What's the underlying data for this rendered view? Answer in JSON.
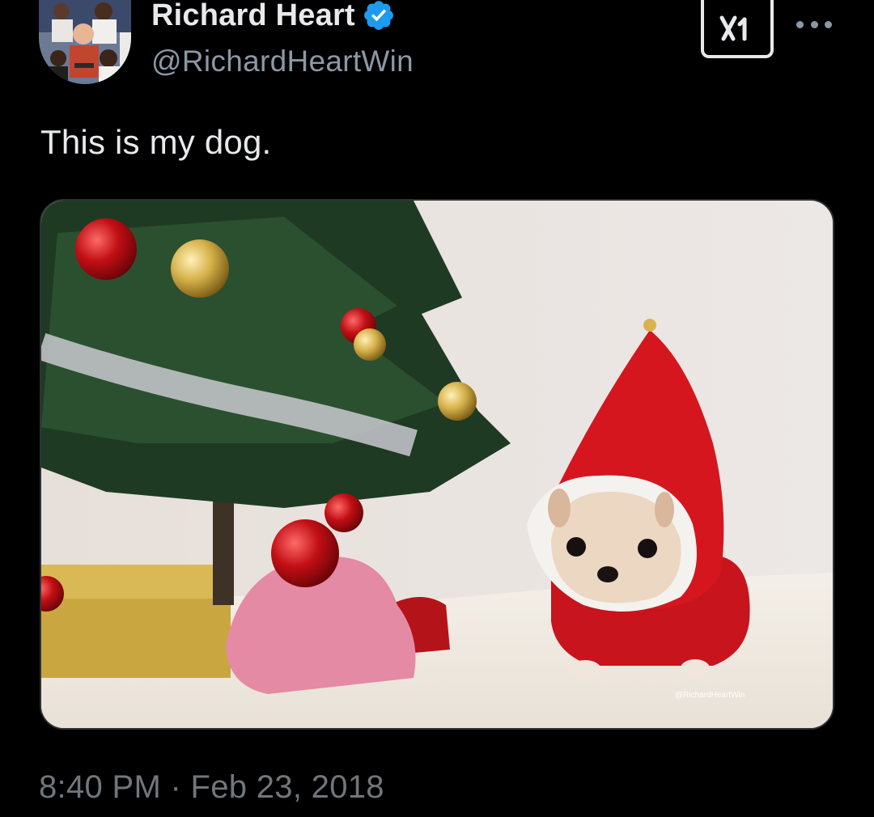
{
  "author": {
    "display_name": "Richard Heart",
    "handle": "@RichardHeartWin",
    "verified_color": "#1d9bf0"
  },
  "tweet": {
    "text": "This is my dog.",
    "timestamp": "8:40 PM · Feb 23, 2018"
  },
  "media": {
    "watermark": "@RichardHeartWin"
  },
  "actions": {
    "grok_icon": "x-ai-logo-icon",
    "more_icon": "more-options-icon"
  },
  "colors": {
    "background": "#000000",
    "text": "#e7e9ea",
    "secondary": "#71767b"
  }
}
